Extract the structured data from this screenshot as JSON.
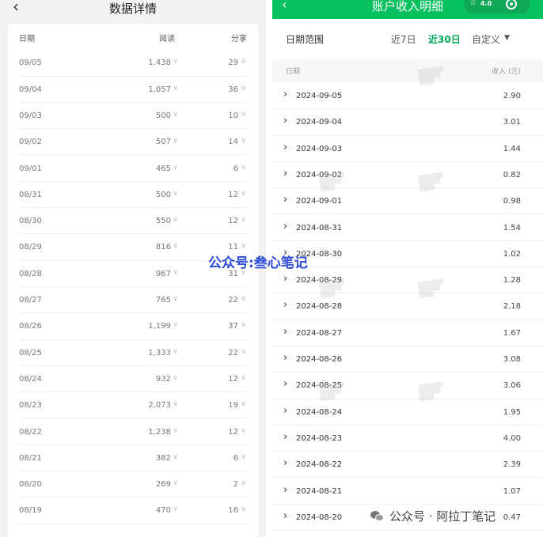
{
  "left_panel": {
    "back_icon": "chevron-left-icon",
    "title": "数据详情",
    "headers": {
      "date": "日期",
      "reads": "阅读",
      "shares": "分享"
    },
    "rows": [
      {
        "date": "09/05",
        "reads": "1,438",
        "shares": "29"
      },
      {
        "date": "09/04",
        "reads": "1,057",
        "shares": "36"
      },
      {
        "date": "09/03",
        "reads": "500",
        "shares": "10"
      },
      {
        "date": "09/02",
        "reads": "507",
        "shares": "14"
      },
      {
        "date": "09/01",
        "reads": "465",
        "shares": "6"
      },
      {
        "date": "08/31",
        "reads": "500",
        "shares": "12"
      },
      {
        "date": "08/30",
        "reads": "550",
        "shares": "12"
      },
      {
        "date": "08/29",
        "reads": "816",
        "shares": "11"
      },
      {
        "date": "08/28",
        "reads": "967",
        "shares": "31"
      },
      {
        "date": "08/27",
        "reads": "765",
        "shares": "22"
      },
      {
        "date": "08/26",
        "reads": "1,199",
        "shares": "37"
      },
      {
        "date": "08/25",
        "reads": "1,333",
        "shares": "22"
      },
      {
        "date": "08/24",
        "reads": "932",
        "shares": "12"
      },
      {
        "date": "08/23",
        "reads": "2,073",
        "shares": "19"
      },
      {
        "date": "08/22",
        "reads": "1,238",
        "shares": "12"
      },
      {
        "date": "08/21",
        "reads": "382",
        "shares": "6"
      },
      {
        "date": "08/20",
        "reads": "269",
        "shares": "2"
      },
      {
        "date": "08/19",
        "reads": "470",
        "shares": "16"
      }
    ]
  },
  "right_panel": {
    "title": "账户收入明细",
    "rating": "4.0",
    "date_range": {
      "label": "日期范围",
      "options": [
        "近7日",
        "近30日",
        "自定义"
      ],
      "selected": "近30日"
    },
    "headers": {
      "date": "日期",
      "income": "收入 (元)"
    },
    "rows": [
      {
        "date": "2024-09-05",
        "amount": "2.90"
      },
      {
        "date": "2024-09-04",
        "amount": "3.01"
      },
      {
        "date": "2024-09-03",
        "amount": "1.44"
      },
      {
        "date": "2024-09-02",
        "amount": "0.82"
      },
      {
        "date": "2024-09-01",
        "amount": "0.98"
      },
      {
        "date": "2024-08-31",
        "amount": "1.54"
      },
      {
        "date": "2024-08-30",
        "amount": "1.02"
      },
      {
        "date": "2024-08-29",
        "amount": "1.28"
      },
      {
        "date": "2024-08-28",
        "amount": "2.18"
      },
      {
        "date": "2024-08-27",
        "amount": "1.67"
      },
      {
        "date": "2024-08-26",
        "amount": "3.08"
      },
      {
        "date": "2024-08-25",
        "amount": "3.06"
      },
      {
        "date": "2024-08-24",
        "amount": "1.95"
      },
      {
        "date": "2024-08-23",
        "amount": "4.00"
      },
      {
        "date": "2024-08-22",
        "amount": "2.39"
      },
      {
        "date": "2024-08-21",
        "amount": "1.07"
      },
      {
        "date": "2024-08-20",
        "amount": "0.47"
      }
    ]
  },
  "overlays": {
    "center_watermark": "公众号:叁心笔记",
    "bottom_watermark": "公众号 · 阿拉丁笔记"
  },
  "colors": {
    "brand_green": "#07c160",
    "active_option": "#07a85a",
    "watermark_blue": "#2c4bd6"
  }
}
